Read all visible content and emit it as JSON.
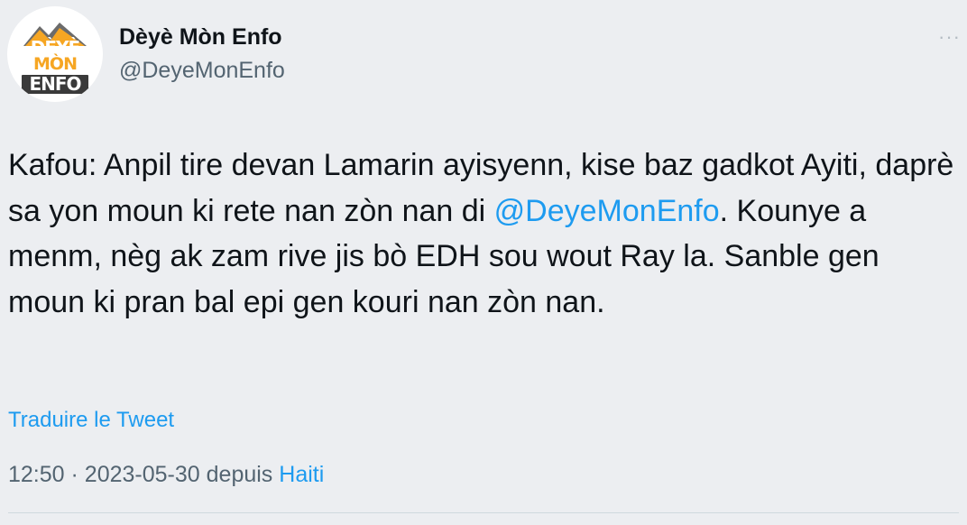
{
  "author": {
    "display_name": "Dèyè Mòn Enfo",
    "handle": "@DeyeMonEnfo",
    "avatar_logo_lines": [
      "DÈYÈ",
      "MÒN",
      "ENFO"
    ]
  },
  "more_options_glyph": "···",
  "tweet": {
    "text_before_mention": "Kafou: Anpil tire devan Lamarin ayisyenn, kise baz gadkot Ayiti, daprè sa yon moun ki rete nan zòn nan di ",
    "mention": "@DeyeMonEnfo",
    "text_after_mention": ". Kounye a menm, nèg ak zam rive jis bò EDH sou wout Ray la. Sanble gen moun ki pran bal epi gen kouri nan zòn nan."
  },
  "translate_link": "Traduire le Tweet",
  "meta": {
    "time": "12:50",
    "separator": "·",
    "date": "2023-05-30",
    "via": "depuis",
    "source": "Haiti"
  },
  "colors": {
    "background": "#eceef1",
    "text": "#0f1419",
    "secondary_text": "#536471",
    "link": "#1d9bf0",
    "logo_orange": "#f6a623"
  }
}
